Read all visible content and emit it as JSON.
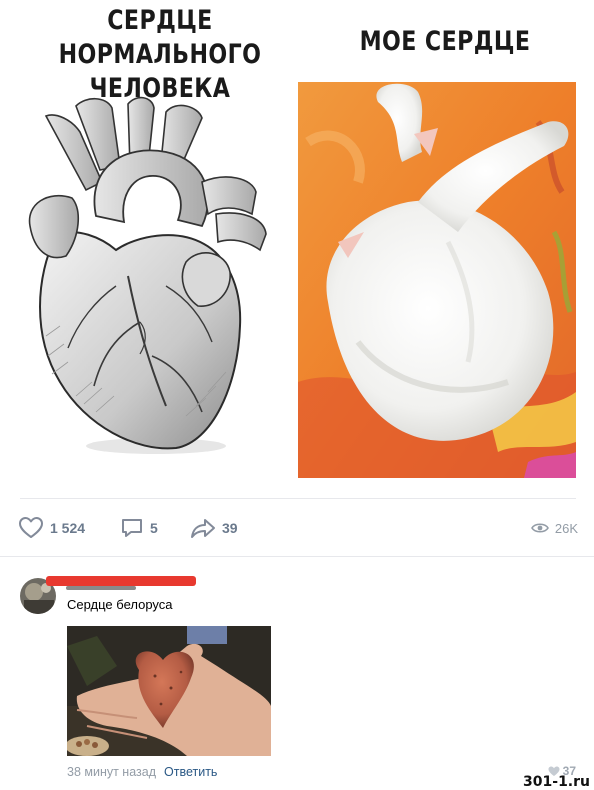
{
  "meme": {
    "caption_left": "СЕРДЦЕ\nНОРМАЛЬНОГО ЧЕЛОВЕКА",
    "caption_right": "МОЕ СЕРДЦЕ"
  },
  "post": {
    "likes": "1 524",
    "comments": "5",
    "shares": "39",
    "views": "26K"
  },
  "comment": {
    "text": "Сердце белоруса",
    "time": "38 минут назад",
    "reply_label": "Ответить",
    "likes": "37"
  },
  "watermark": "301-1.ru",
  "colors": {
    "action_gray": "#828a99",
    "link_blue": "#2a5885",
    "redaction_red": "#e8392f",
    "divider": "#e7e8ec"
  }
}
